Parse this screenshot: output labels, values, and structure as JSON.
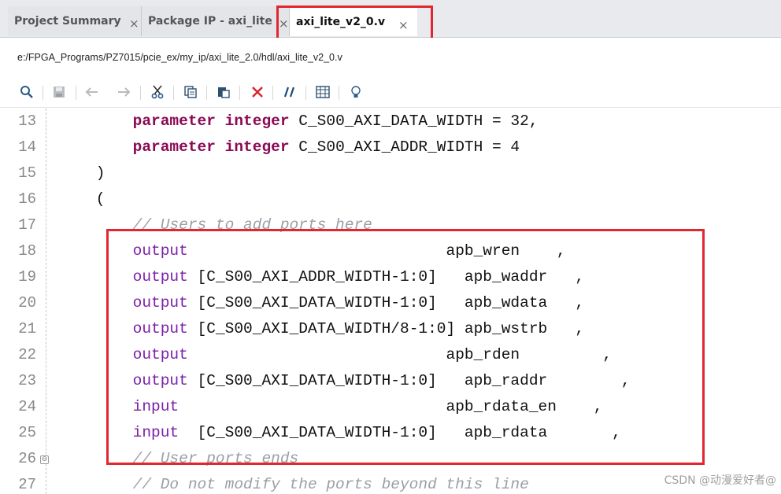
{
  "tabs": [
    {
      "label": "Project Summary",
      "close": "×"
    },
    {
      "label": "Package IP - axi_lite",
      "close": "×"
    },
    {
      "label": "axi_lite_v2_0.v",
      "close": "×"
    }
  ],
  "file_path": "e:/FPGA_Programs/PZ7015/pcie_ex/my_ip/axi_lite_2.0/hdl/axi_lite_v2_0.v",
  "toolbar": [
    "search-icon",
    "save-icon",
    "undo-icon",
    "redo-icon",
    "cut-icon",
    "copy-icon",
    "paste-icon",
    "delete-icon",
    "comment-icon",
    "column-select-icon",
    "bulb-icon"
  ],
  "colors": {
    "accent_red": "#e32630",
    "keyword": "#8a0a55",
    "port_dir": "#7c1fa8",
    "comment": "#9aa0a6"
  },
  "code_lines": [
    {
      "num": "13",
      "indent": "        ",
      "kw1": "parameter",
      "kw2": "integer",
      "rest": " C_S00_AXI_DATA_WIDTH = 32,"
    },
    {
      "num": "14",
      "indent": "        ",
      "kw1": "parameter",
      "kw2": "integer",
      "rest": " C_S00_AXI_ADDR_WIDTH = 4"
    },
    {
      "num": "15",
      "text": "    )"
    },
    {
      "num": "16",
      "text": "    ("
    },
    {
      "num": "17",
      "comment": "        // Users to add ports here"
    },
    {
      "num": "18",
      "dir": "output",
      "rest": "                            apb_wren    ,"
    },
    {
      "num": "19",
      "dir": "output",
      "rest": " [C_S00_AXI_ADDR_WIDTH-1:0]   apb_waddr   ,"
    },
    {
      "num": "20",
      "dir": "output",
      "rest": " [C_S00_AXI_DATA_WIDTH-1:0]   apb_wdata   ,"
    },
    {
      "num": "21",
      "dir": "output",
      "rest": " [C_S00_AXI_DATA_WIDTH/8-1:0] apb_wstrb   ,"
    },
    {
      "num": "22",
      "dir": "output",
      "rest": "                            apb_rden         ,"
    },
    {
      "num": "23",
      "dir": "output",
      "rest": " [C_S00_AXI_DATA_WIDTH-1:0]   apb_raddr        ,"
    },
    {
      "num": "24",
      "dir": "input",
      "rest": "                             apb_rdata_en    ,"
    },
    {
      "num": "25",
      "dir": "input",
      "rest": "  [C_S00_AXI_DATA_WIDTH-1:0]   apb_rdata       ,"
    },
    {
      "num": "26",
      "comment": "        // User ports ends"
    },
    {
      "num": "27",
      "comment": "        // Do not modify the ports beyond this line"
    }
  ],
  "fold_marker": "⊖",
  "watermark": "CSDN @动漫爱好者@"
}
